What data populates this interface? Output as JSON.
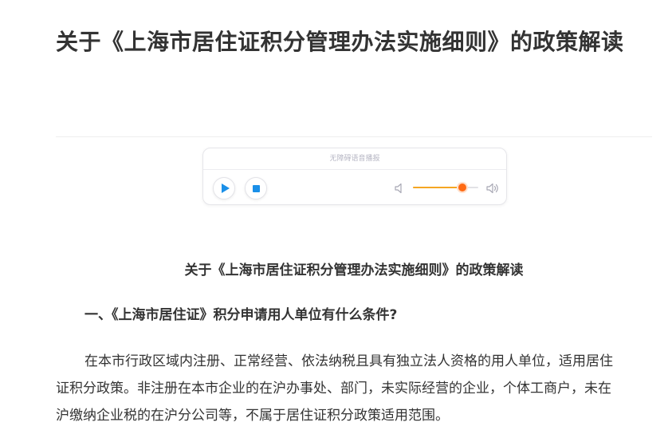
{
  "article": {
    "title": "关于《上海市居住证积分管理办法实施细则》的政策解读",
    "heading": "关于《上海市居住证积分管理办法实施细则》的政策解读",
    "section_1_heading": "一、《上海市居住证》积分申请用人单位有什么条件?",
    "section_1_lines": [
      "在本市行政区域内注册、正常经营、依法纳税且具有独立法人资格的用人单位，适用居住",
      "证积分政策。非注册在本市企业的在沪办事处、部门，未实际经营的企业，个体工商户，未在",
      "沪缴纳企业税的在沪分公司等，不属于居住证积分政策适用范围。"
    ]
  },
  "audio_player": {
    "label": "无障碍语音播报",
    "volume_percent": 75,
    "icons": {
      "play": "play-icon",
      "stop": "stop-icon",
      "volume_low": "volume-low-icon",
      "volume_high": "volume-high-icon"
    },
    "colors": {
      "button_icon": "#1a8fe8",
      "volume_fill": "#f5a623",
      "volume_knob": "#ff6a13"
    }
  }
}
